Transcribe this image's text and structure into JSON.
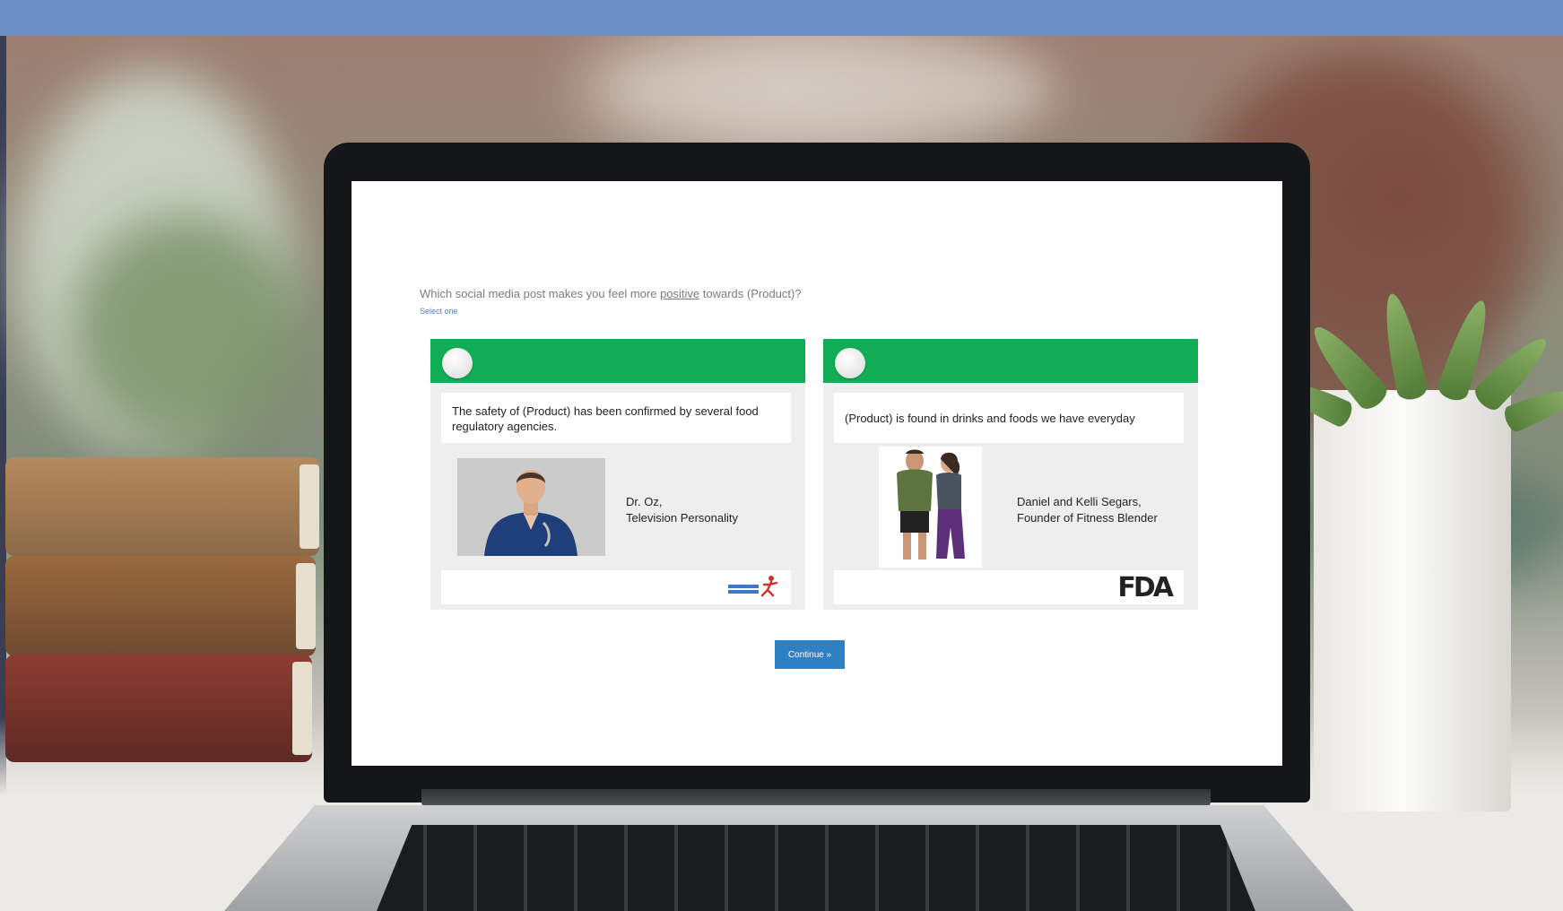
{
  "survey": {
    "question_before": "Which social media post makes you feel more ",
    "question_emphasis": "positive",
    "question_after": " towards (Product)?",
    "instruction": "Select one",
    "continue_label": "Continue »"
  },
  "cards": [
    {
      "statement": "The safety of (Product) has been confirmed by several food regulatory agencies.",
      "person_name": "Dr. Oz,",
      "person_title": "Television Personality"
    },
    {
      "statement": "(Product) is found in drinks and foods we have everyday",
      "person_name": "Daniel and Kelli Segars,",
      "person_title": "Founder of Fitness Blender",
      "logo_text": "FDA"
    }
  ],
  "colors": {
    "top_bar": "#6b8ec4",
    "card_header": "#10ad56",
    "continue_button": "#2f7fc4",
    "link": "#4a7fc8"
  },
  "icons": {
    "radio": "radio-circle-icon",
    "left_logo": "running-figure-logo-icon",
    "right_logo": "fda-logo"
  }
}
